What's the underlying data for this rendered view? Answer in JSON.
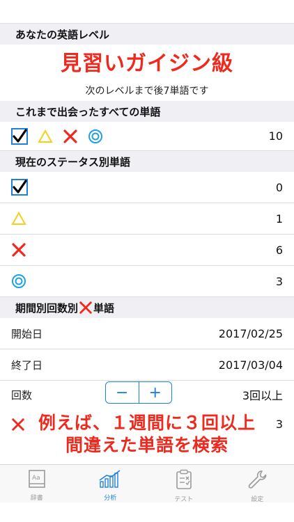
{
  "level_section": {
    "header": "あなたの英語レベル",
    "level_name": "見習いガイジン級",
    "next_level_text": "次のレベルまで後7単語です"
  },
  "all_words_section": {
    "header": "これまで出会ったすべての単語",
    "count": "10"
  },
  "status_section": {
    "header": "現在のステータス別単語",
    "rows": [
      {
        "icon": "check-icon",
        "count": "0"
      },
      {
        "icon": "triangle-icon",
        "count": "1"
      },
      {
        "icon": "cross-icon",
        "count": "6"
      },
      {
        "icon": "double-circle-icon",
        "count": "3"
      }
    ]
  },
  "period_section": {
    "header_prefix": "期間別回数別",
    "header_suffix": "単語",
    "start_label": "開始日",
    "start_value": "2017/02/25",
    "end_label": "終了日",
    "end_value": "2017/03/04",
    "count_label": "回数",
    "count_value": "3回以上",
    "stepper_minus": "−",
    "stepper_plus": "+",
    "result_count": "3"
  },
  "overlay": {
    "line1": "例えば、１週間に３回以上",
    "line2": "間違えた単語を検索"
  },
  "tabbar": {
    "tabs": [
      {
        "label": "辞書",
        "icon": "dictionary-icon"
      },
      {
        "label": "分析",
        "icon": "analysis-chart-icon"
      },
      {
        "label": "テスト",
        "icon": "test-clipboard-icon"
      },
      {
        "label": "設定",
        "icon": "settings-wrench-icon"
      }
    ],
    "active_color": "#1f7fe0",
    "inactive_color": "#9a9a9a"
  },
  "colors": {
    "accent_red": "#ee2a1f",
    "accent_blue": "#1f7fe0",
    "triangle_yellow": "#f0d21a",
    "section_bg": "#efeff4"
  }
}
